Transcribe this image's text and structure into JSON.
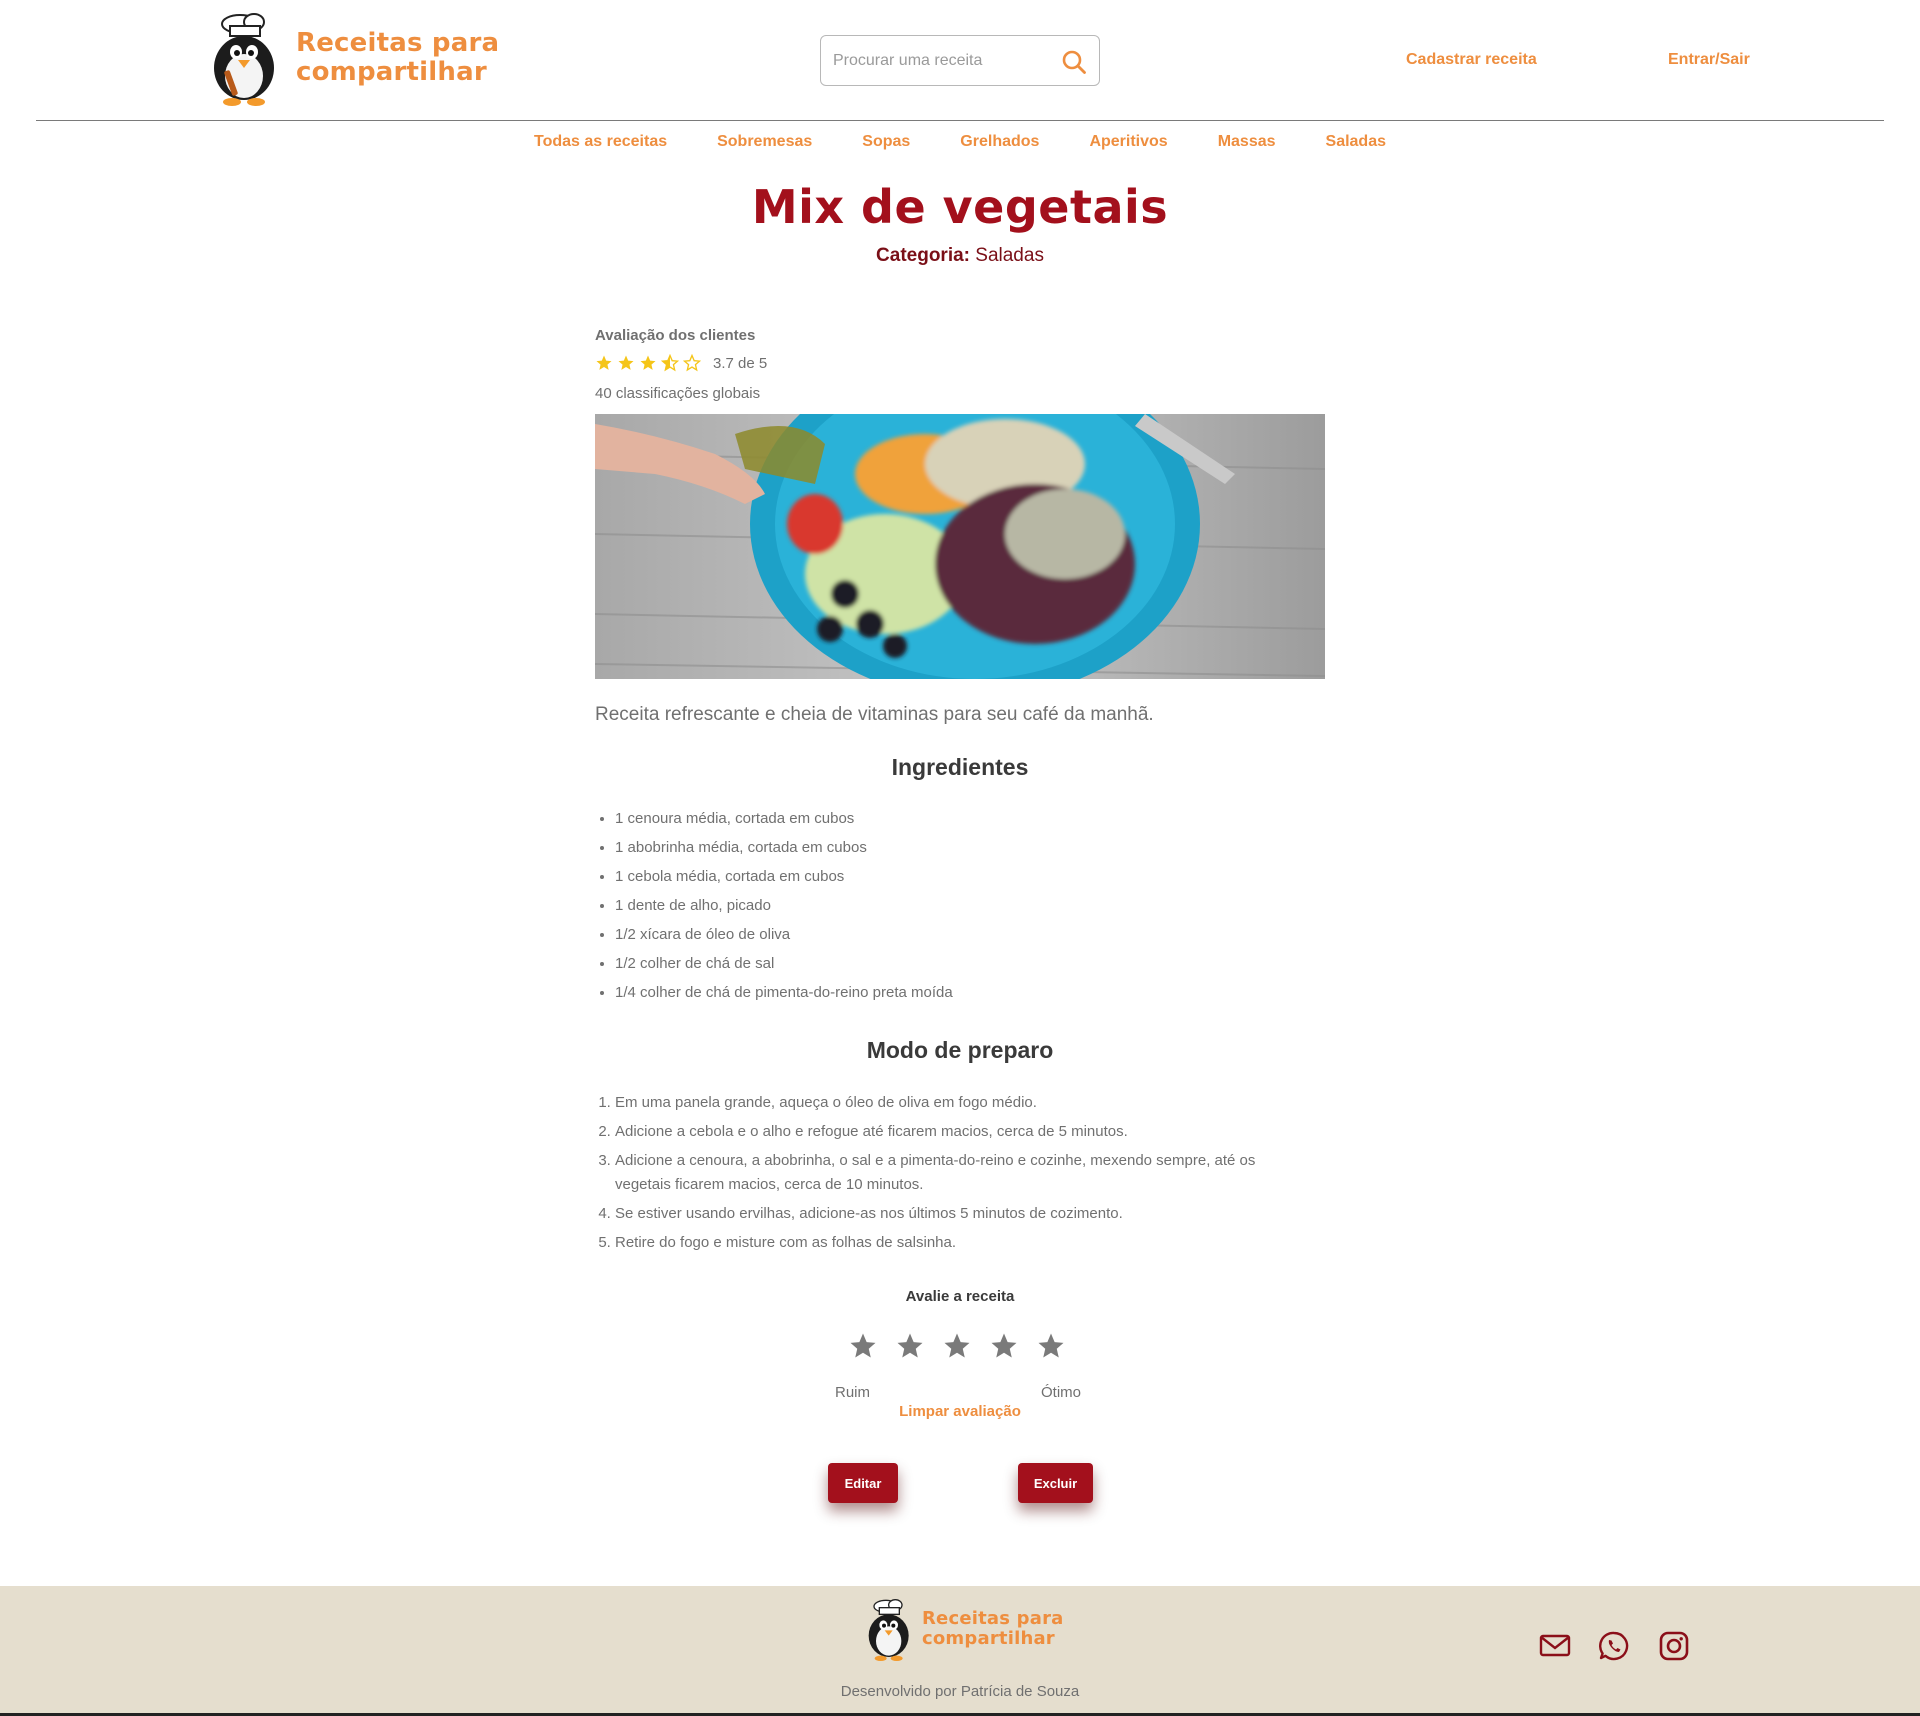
{
  "header": {
    "logo": {
      "line1": "Receitas para",
      "line2": "compartilhar"
    },
    "search": {
      "placeholder": "Procurar uma receita",
      "value": ""
    },
    "links": {
      "register_recipe": "Cadastrar receita",
      "login_logout": "Entrar/Sair"
    }
  },
  "nav": {
    "categories": [
      "Todas as receitas",
      "Sobremesas",
      "Sopas",
      "Grelhados",
      "Aperitivos",
      "Massas",
      "Saladas"
    ]
  },
  "recipe": {
    "title": "Mix de vegetais",
    "category_label": "Categoria:",
    "category_value": "Saladas",
    "rating": {
      "title": "Avaliação dos clientes",
      "value": 3.7,
      "value_text": "3.7 de 5",
      "count_text": "40 classificações globais"
    },
    "description": "Receita refrescante e cheia de vitaminas para seu café da manhã.",
    "ingredients_title": "Ingredientes",
    "ingredients": [
      "1 cenoura média, cortada em cubos",
      "1 abobrinha média, cortada em cubos",
      "1 cebola média, cortada em cubos",
      "1 dente de alho, picado",
      "1/2 xícara de óleo de oliva",
      "1/2 colher de chá de sal",
      "1/4 colher de chá de pimenta-do-reino preta moída"
    ],
    "steps_title": "Modo de preparo",
    "steps": [
      "Em uma panela grande, aqueça o óleo de oliva em fogo médio.",
      "Adicione a cebola e o alho e refogue até ficarem macios, cerca de 5 minutos.",
      "Adicione a cenoura, a abobrinha, o sal e a pimenta-do-reino e cozinhe, mexendo sempre, até os vegetais ficarem macios, cerca de 10 minutos.",
      "Se estiver usando ervilhas, adicione-as nos últimos 5 minutos de cozimento.",
      "Retire do fogo e misture com as folhas de salsinha."
    ]
  },
  "rate": {
    "title": "Avalie a receita",
    "low_label": "Ruim",
    "high_label": "Ótimo",
    "clear_label": "Limpar avaliação"
  },
  "actions": {
    "edit": "Editar",
    "delete": "Excluir"
  },
  "footer": {
    "logo": {
      "line1": "Receitas para",
      "line2": "compartilhar"
    },
    "credit": "Desenvolvido por Patrícia de Souza",
    "social_icons": [
      "mail-icon",
      "whatsapp-icon",
      "instagram-icon"
    ]
  },
  "colors": {
    "accent_orange": "#ee8e3f",
    "brand_red": "#a3101c",
    "footer_bg": "#e5dece",
    "star_gold": "#f5c518",
    "star_grey": "#7a7a7a"
  }
}
